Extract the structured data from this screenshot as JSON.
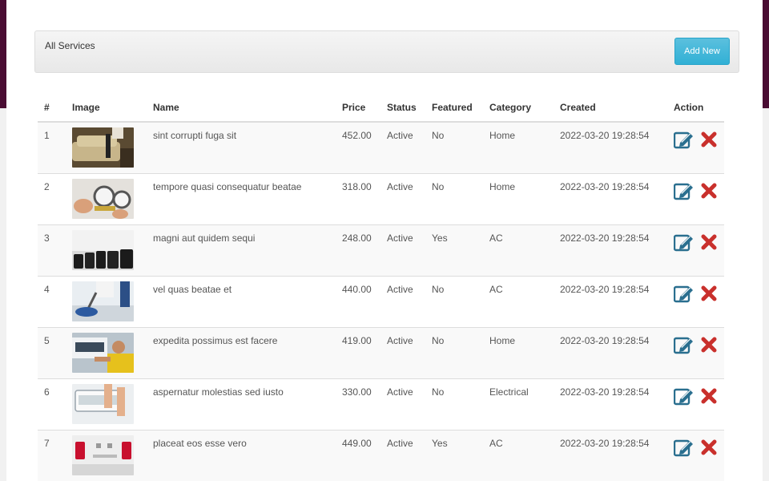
{
  "panel": {
    "title": "All Services",
    "add_label": "Add New"
  },
  "table": {
    "headers": [
      "#",
      "Image",
      "Name",
      "Price",
      "Status",
      "Featured",
      "Category",
      "Created",
      "Action"
    ],
    "rows": [
      {
        "num": "1",
        "name": "sint corrupti fuga sit",
        "price": "452.00",
        "status": "Active",
        "featured": "No",
        "category": "Home",
        "created": "2022-03-20 19:28:54",
        "image": "sofa-cleaning"
      },
      {
        "num": "2",
        "name": "tempore quasi consequatur beatae",
        "price": "318.00",
        "status": "Active",
        "featured": "No",
        "category": "Home",
        "created": "2022-03-20 19:28:54",
        "image": "pressure-gauges"
      },
      {
        "num": "3",
        "name": "magni aut quidem sequi",
        "price": "248.00",
        "status": "Active",
        "featured": "Yes",
        "category": "AC",
        "created": "2022-03-20 19:28:54",
        "image": "weight-plates"
      },
      {
        "num": "4",
        "name": "vel quas beatae et",
        "price": "440.00",
        "status": "Active",
        "featured": "No",
        "category": "AC",
        "created": "2022-03-20 19:28:54",
        "image": "floor-polisher"
      },
      {
        "num": "5",
        "name": "expedita possimus est facere",
        "price": "419.00",
        "status": "Active",
        "featured": "No",
        "category": "Home",
        "created": "2022-03-20 19:28:54",
        "image": "ac-technician"
      },
      {
        "num": "6",
        "name": "aspernatur molestias sed iusto",
        "price": "330.00",
        "status": "Active",
        "featured": "No",
        "category": "Electrical",
        "created": "2022-03-20 19:28:54",
        "image": "ac-filter"
      },
      {
        "num": "7",
        "name": "placeat eos esse vero",
        "price": "449.00",
        "status": "Active",
        "featured": "Yes",
        "category": "AC",
        "created": "2022-03-20 19:28:54",
        "image": "office-chairs"
      }
    ]
  },
  "colors": {
    "accent": "#4a0d33",
    "button": "#5bc0de",
    "edit_icon": "#2a6f8f",
    "delete_icon": "#c9302c"
  }
}
